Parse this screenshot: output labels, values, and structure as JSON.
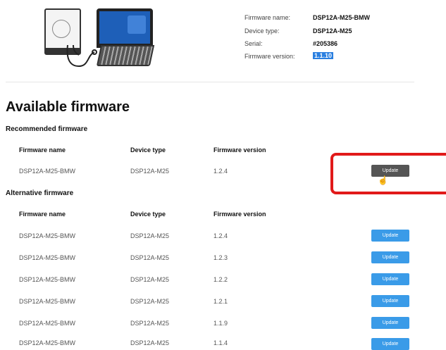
{
  "device_info": {
    "firmware_name_label": "Firmware name:",
    "firmware_name": "DSP12A-M25-BMW",
    "device_type_label": "Device type:",
    "device_type": "DSP12A-M25",
    "serial_label": "Serial:",
    "serial": "#205386",
    "firmware_version_label": "Firmware version:",
    "firmware_version": "1.1.10"
  },
  "page_title": "Available firmware",
  "recommended": {
    "title": "Recommended firmware",
    "columns": [
      "Firmware name",
      "Device type",
      "Firmware version"
    ],
    "row": {
      "name": "DSP12A-M25-BMW",
      "type": "DSP12A-M25",
      "version": "1.2.4",
      "button": "Update"
    }
  },
  "alternative": {
    "title": "Alternative firmware",
    "columns": [
      "Firmware name",
      "Device type",
      "Firmware version"
    ],
    "rows": [
      {
        "name": "DSP12A-M25-BMW",
        "type": "DSP12A-M25",
        "version": "1.2.4",
        "button": "Update"
      },
      {
        "name": "DSP12A-M25-BMW",
        "type": "DSP12A-M25",
        "version": "1.2.3",
        "button": "Update"
      },
      {
        "name": "DSP12A-M25-BMW",
        "type": "DSP12A-M25",
        "version": "1.2.2",
        "button": "Update"
      },
      {
        "name": "DSP12A-M25-BMW",
        "type": "DSP12A-M25",
        "version": "1.2.1",
        "button": "Update"
      },
      {
        "name": "DSP12A-M25-BMW",
        "type": "DSP12A-M25",
        "version": "1.1.9",
        "button": "Update"
      },
      {
        "name": "DSP12A-M25-BMW",
        "type": "DSP12A-M25",
        "version": "1.1.4",
        "button": "Update"
      }
    ]
  },
  "colors": {
    "update_blue": "#3a9be8",
    "update_dark": "#555555",
    "highlight_red": "#e11a1a",
    "selection_blue": "#2a7fe0"
  },
  "icons": [
    "dsp-device-icon",
    "laptop-icon",
    "usb-cable-icon",
    "hand-cursor-icon"
  ]
}
